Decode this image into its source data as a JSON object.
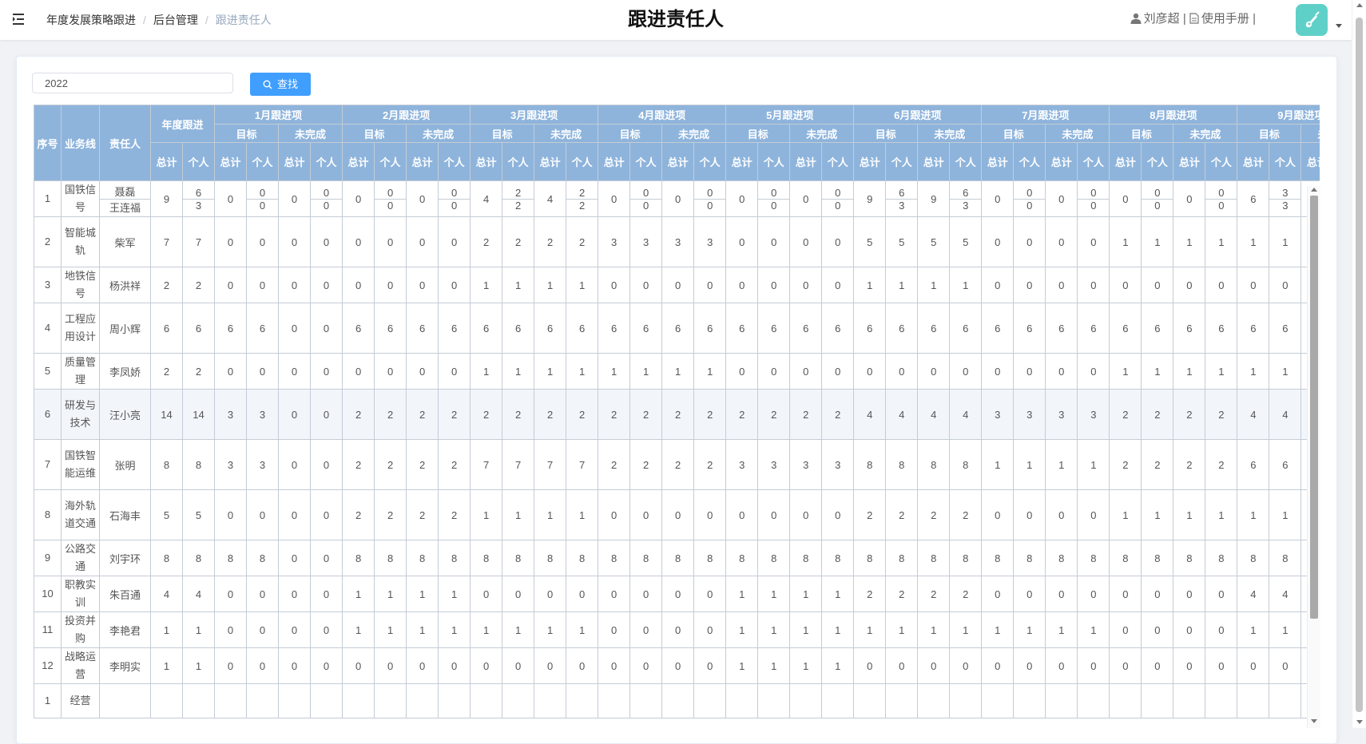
{
  "header": {
    "breadcrumb": [
      "年度发展策略跟进",
      "后台管理",
      "跟进责任人"
    ],
    "breadcrumb_separator": "/",
    "title": "跟进责任人",
    "user_name": "刘彦超",
    "divider": "|",
    "manual_label": "使用手册"
  },
  "search": {
    "year_value": "2022",
    "button_label": "查找"
  },
  "colors": {
    "primary": "#409eff",
    "header_bg": "#8eb4dc",
    "avatar_bg": "#5fd0c8"
  },
  "table": {
    "headers": {
      "seq": "序号",
      "line": "业务线",
      "owner": "责任人",
      "annual": "年度跟进",
      "target": "目标",
      "unfinished": "未完成",
      "total": "总计",
      "personal": "个人"
    },
    "months": [
      "1月跟进项",
      "2月跟进项",
      "3月跟进项",
      "4月跟进项",
      "5月跟进项",
      "6月跟进项",
      "7月跟进项",
      "8月跟进项",
      "9月跟进项"
    ],
    "rows": [
      {
        "seq": "1",
        "line": "国铁信号",
        "people": [
          "聂磊",
          "王连福"
        ],
        "annual": [
          "9",
          [
            "6",
            "3"
          ]
        ],
        "months": [
          [
            "0",
            [
              "0",
              "0"
            ],
            "0",
            [
              "0",
              "0"
            ]
          ],
          [
            "0",
            [
              "0",
              "0"
            ],
            "0",
            [
              "0",
              "0"
            ]
          ],
          [
            "4",
            [
              "2",
              "2"
            ],
            "4",
            [
              "2",
              "2"
            ]
          ],
          [
            "0",
            [
              "0",
              "0"
            ],
            "0",
            [
              "0",
              "0"
            ]
          ],
          [
            "0",
            [
              "0",
              "0"
            ],
            "0",
            [
              "0",
              "0"
            ]
          ],
          [
            "9",
            [
              "6",
              "3"
            ],
            "9",
            [
              "6",
              "3"
            ]
          ],
          [
            "0",
            [
              "0",
              "0"
            ],
            "0",
            [
              "0",
              "0"
            ]
          ],
          [
            "0",
            [
              "0",
              "0"
            ],
            "0",
            [
              "0",
              "0"
            ]
          ],
          [
            "6",
            [
              "3",
              "3"
            ],
            "",
            [
              "",
              ""
            ]
          ]
        ]
      },
      {
        "seq": "2",
        "line": "智能城轨",
        "people": [
          "柴军"
        ],
        "annual": [
          "7",
          "7"
        ],
        "months": [
          [
            "0",
            "0",
            "0",
            "0"
          ],
          [
            "0",
            "0",
            "0",
            "0"
          ],
          [
            "2",
            "2",
            "2",
            "2"
          ],
          [
            "3",
            "3",
            "3",
            "3"
          ],
          [
            "0",
            "0",
            "0",
            "0"
          ],
          [
            "5",
            "5",
            "5",
            "5"
          ],
          [
            "0",
            "0",
            "0",
            "0"
          ],
          [
            "1",
            "1",
            "1",
            "1"
          ],
          [
            "1",
            "1",
            "",
            ""
          ]
        ]
      },
      {
        "seq": "3",
        "line": "地铁信号",
        "people": [
          "杨洪祥"
        ],
        "annual": [
          "2",
          "2"
        ],
        "months": [
          [
            "0",
            "0",
            "0",
            "0"
          ],
          [
            "0",
            "0",
            "0",
            "0"
          ],
          [
            "1",
            "1",
            "1",
            "1"
          ],
          [
            "0",
            "0",
            "0",
            "0"
          ],
          [
            "0",
            "0",
            "0",
            "0"
          ],
          [
            "1",
            "1",
            "1",
            "1"
          ],
          [
            "0",
            "0",
            "0",
            "0"
          ],
          [
            "0",
            "0",
            "0",
            "0"
          ],
          [
            "0",
            "0",
            "",
            ""
          ]
        ]
      },
      {
        "seq": "4",
        "line": "工程应用设计",
        "people": [
          "周小辉"
        ],
        "annual": [
          "6",
          "6"
        ],
        "months": [
          [
            "6",
            "6",
            "0",
            "0"
          ],
          [
            "6",
            "6",
            "6",
            "6"
          ],
          [
            "6",
            "6",
            "6",
            "6"
          ],
          [
            "6",
            "6",
            "6",
            "6"
          ],
          [
            "6",
            "6",
            "6",
            "6"
          ],
          [
            "6",
            "6",
            "6",
            "6"
          ],
          [
            "6",
            "6",
            "6",
            "6"
          ],
          [
            "6",
            "6",
            "6",
            "6"
          ],
          [
            "6",
            "6",
            "",
            ""
          ]
        ]
      },
      {
        "seq": "5",
        "line": "质量管理",
        "people": [
          "李凤娇"
        ],
        "annual": [
          "2",
          "2"
        ],
        "months": [
          [
            "0",
            "0",
            "0",
            "0"
          ],
          [
            "0",
            "0",
            "0",
            "0"
          ],
          [
            "1",
            "1",
            "1",
            "1"
          ],
          [
            "1",
            "1",
            "1",
            "1"
          ],
          [
            "0",
            "0",
            "0",
            "0"
          ],
          [
            "0",
            "0",
            "0",
            "0"
          ],
          [
            "0",
            "0",
            "0",
            "0"
          ],
          [
            "1",
            "1",
            "1",
            "1"
          ],
          [
            "1",
            "1",
            "",
            ""
          ]
        ]
      },
      {
        "seq": "6",
        "line": "研发与技术",
        "people": [
          "汪小亮"
        ],
        "annual": [
          "14",
          "14"
        ],
        "months": [
          [
            "3",
            "3",
            "0",
            "0"
          ],
          [
            "2",
            "2",
            "2",
            "2"
          ],
          [
            "2",
            "2",
            "2",
            "2"
          ],
          [
            "2",
            "2",
            "2",
            "2"
          ],
          [
            "2",
            "2",
            "2",
            "2"
          ],
          [
            "4",
            "4",
            "4",
            "4"
          ],
          [
            "3",
            "3",
            "3",
            "3"
          ],
          [
            "2",
            "2",
            "2",
            "2"
          ],
          [
            "4",
            "4",
            "",
            ""
          ]
        ]
      },
      {
        "seq": "7",
        "line": "国铁智能运维",
        "people": [
          "张明"
        ],
        "annual": [
          "8",
          "8"
        ],
        "months": [
          [
            "3",
            "3",
            "0",
            "0"
          ],
          [
            "2",
            "2",
            "2",
            "2"
          ],
          [
            "7",
            "7",
            "7",
            "7"
          ],
          [
            "2",
            "2",
            "2",
            "2"
          ],
          [
            "3",
            "3",
            "3",
            "3"
          ],
          [
            "8",
            "8",
            "8",
            "8"
          ],
          [
            "1",
            "1",
            "1",
            "1"
          ],
          [
            "2",
            "2",
            "2",
            "2"
          ],
          [
            "6",
            "6",
            "",
            ""
          ]
        ]
      },
      {
        "seq": "8",
        "line": "海外轨道交通",
        "people": [
          "石海丰"
        ],
        "annual": [
          "5",
          "5"
        ],
        "months": [
          [
            "0",
            "0",
            "0",
            "0"
          ],
          [
            "2",
            "2",
            "2",
            "2"
          ],
          [
            "1",
            "1",
            "1",
            "1"
          ],
          [
            "0",
            "0",
            "0",
            "0"
          ],
          [
            "0",
            "0",
            "0",
            "0"
          ],
          [
            "2",
            "2",
            "2",
            "2"
          ],
          [
            "0",
            "0",
            "0",
            "0"
          ],
          [
            "1",
            "1",
            "1",
            "1"
          ],
          [
            "1",
            "1",
            "",
            ""
          ]
        ]
      },
      {
        "seq": "9",
        "line": "公路交通",
        "people": [
          "刘宇环"
        ],
        "annual": [
          "8",
          "8"
        ],
        "months": [
          [
            "8",
            "8",
            "0",
            "0"
          ],
          [
            "8",
            "8",
            "8",
            "8"
          ],
          [
            "8",
            "8",
            "8",
            "8"
          ],
          [
            "8",
            "8",
            "8",
            "8"
          ],
          [
            "8",
            "8",
            "8",
            "8"
          ],
          [
            "8",
            "8",
            "8",
            "8"
          ],
          [
            "8",
            "8",
            "8",
            "8"
          ],
          [
            "8",
            "8",
            "8",
            "8"
          ],
          [
            "8",
            "8",
            "",
            ""
          ]
        ]
      },
      {
        "seq": "10",
        "line": "职教实训",
        "people": [
          "朱百通"
        ],
        "annual": [
          "4",
          "4"
        ],
        "months": [
          [
            "0",
            "0",
            "0",
            "0"
          ],
          [
            "1",
            "1",
            "1",
            "1"
          ],
          [
            "0",
            "0",
            "0",
            "0"
          ],
          [
            "0",
            "0",
            "0",
            "0"
          ],
          [
            "1",
            "1",
            "1",
            "1"
          ],
          [
            "2",
            "2",
            "2",
            "2"
          ],
          [
            "0",
            "0",
            "0",
            "0"
          ],
          [
            "0",
            "0",
            "0",
            "0"
          ],
          [
            "4",
            "4",
            "",
            ""
          ]
        ]
      },
      {
        "seq": "11",
        "line": "投资并购",
        "people": [
          "李艳君"
        ],
        "annual": [
          "1",
          "1"
        ],
        "months": [
          [
            "0",
            "0",
            "0",
            "0"
          ],
          [
            "1",
            "1",
            "1",
            "1"
          ],
          [
            "1",
            "1",
            "1",
            "1"
          ],
          [
            "0",
            "0",
            "0",
            "0"
          ],
          [
            "1",
            "1",
            "1",
            "1"
          ],
          [
            "1",
            "1",
            "1",
            "1"
          ],
          [
            "1",
            "1",
            "1",
            "1"
          ],
          [
            "0",
            "0",
            "0",
            "0"
          ],
          [
            "1",
            "1",
            "",
            ""
          ]
        ]
      },
      {
        "seq": "12",
        "line": "战略运营",
        "people": [
          "李明实"
        ],
        "annual": [
          "1",
          "1"
        ],
        "months": [
          [
            "0",
            "0",
            "0",
            "0"
          ],
          [
            "0",
            "0",
            "0",
            "0"
          ],
          [
            "0",
            "0",
            "0",
            "0"
          ],
          [
            "0",
            "0",
            "0",
            "0"
          ],
          [
            "1",
            "1",
            "1",
            "1"
          ],
          [
            "0",
            "0",
            "0",
            "0"
          ],
          [
            "0",
            "0",
            "0",
            "0"
          ],
          [
            "0",
            "0",
            "0",
            "0"
          ],
          [
            "0",
            "0",
            "",
            ""
          ]
        ]
      },
      {
        "seq": "1",
        "line": "经营",
        "people": [
          ""
        ],
        "annual": [
          "",
          ""
        ],
        "months": [
          [
            "",
            "",
            "",
            ""
          ],
          [
            "",
            "",
            "",
            ""
          ],
          [
            "",
            "",
            "",
            ""
          ],
          [
            "",
            "",
            "",
            ""
          ],
          [
            "",
            "",
            "",
            ""
          ],
          [
            "",
            "",
            "",
            ""
          ],
          [
            "",
            "",
            "",
            ""
          ],
          [
            "",
            "",
            "",
            ""
          ],
          [
            "",
            "",
            "",
            ""
          ]
        ]
      }
    ]
  }
}
